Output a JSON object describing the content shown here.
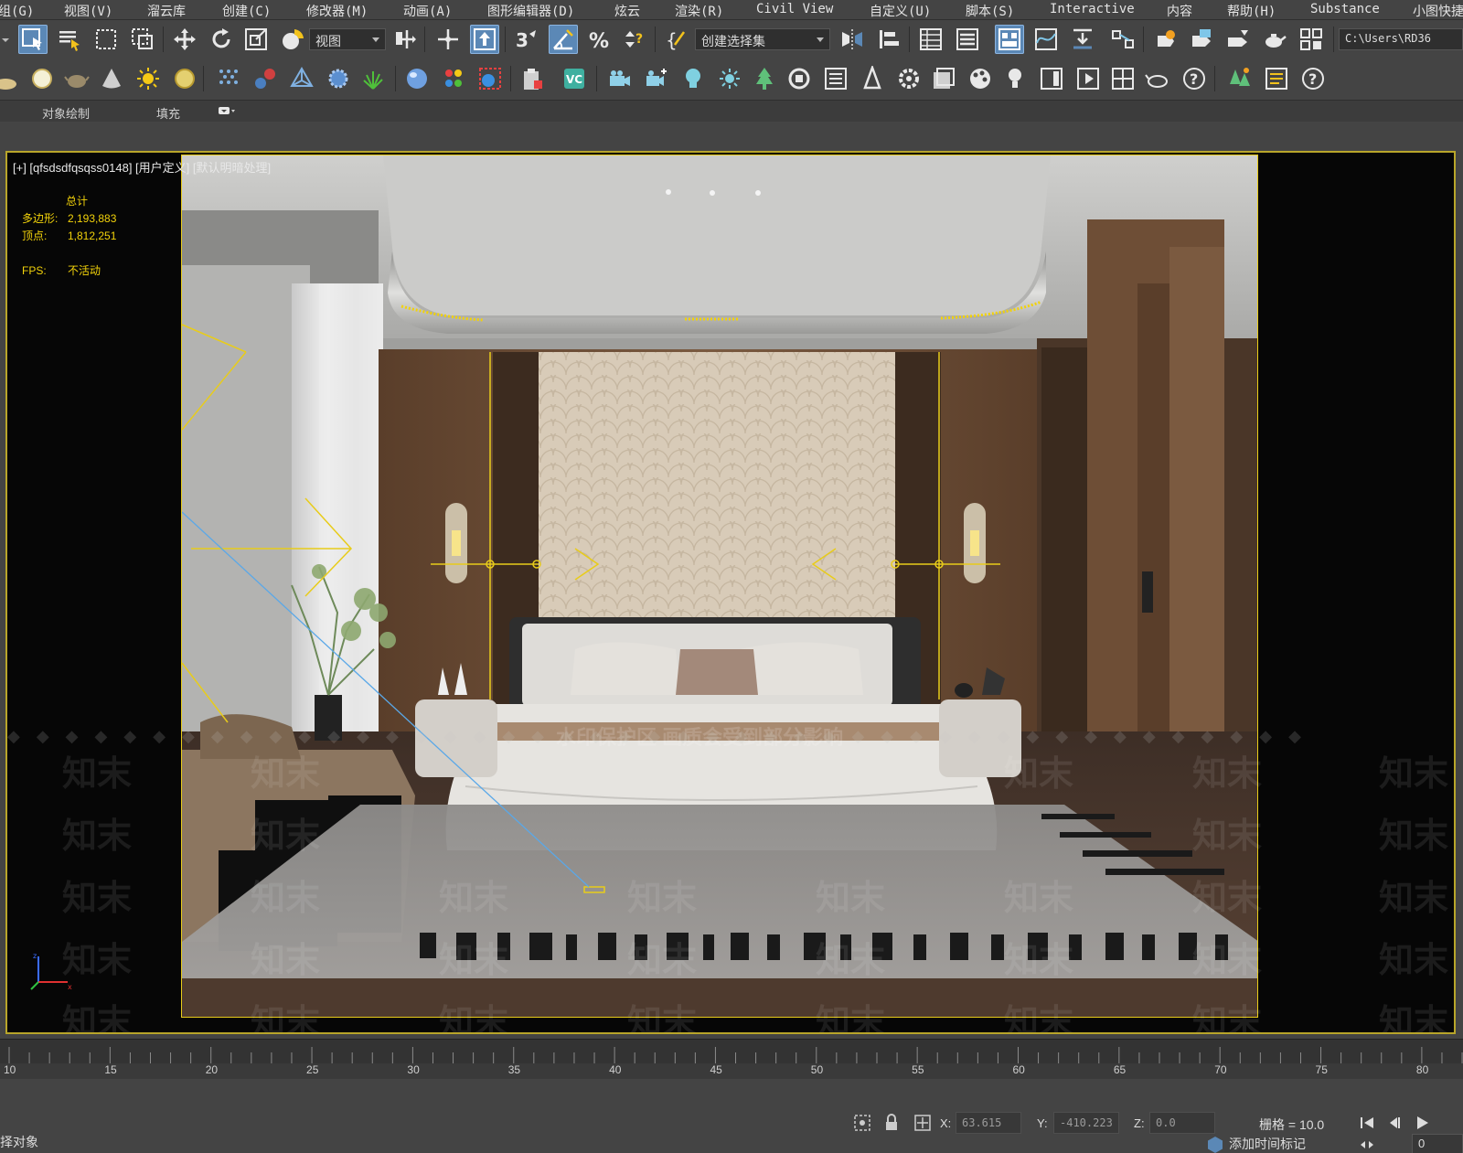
{
  "menubar": {
    "items": [
      "组(G)",
      "视图(V)",
      "溜云库",
      "创建(C)",
      "修改器(M)",
      "动画(A)",
      "图形编辑器(D)",
      "炫云",
      "渲染(R)",
      "Civil View",
      "自定义(U)",
      "脚本(S)",
      "Interactive",
      "内容",
      "帮助(H)",
      "Substance",
      "小图快捷"
    ]
  },
  "toolbar1": {
    "view_dropdown": "视图",
    "selection_set_dropdown": "创建选择集",
    "path_field": "C:\\Users\\RD36"
  },
  "ribbon": {
    "tab_object_paint": "对象绘制",
    "tab_fill": "填充"
  },
  "viewport": {
    "label": "[+] [qfsdsdfqsqss0148] [用户定义] [默认明暗处理]",
    "stats": {
      "total_label": "总计",
      "polys_label": "多边形:",
      "polys_value": "2,193,883",
      "verts_label": "顶点:",
      "verts_value": "1,812,251",
      "fps_label": "FPS:",
      "fps_value": "不活动"
    },
    "watermark_text": "知末",
    "watermark_notice": "水印保护区 画质会受到部分影响"
  },
  "timeline": {
    "ticks": [
      "10",
      "15",
      "20",
      "25",
      "30",
      "35",
      "40",
      "45",
      "50",
      "55",
      "60",
      "65",
      "70",
      "75",
      "80"
    ]
  },
  "statusbar": {
    "left_text": "择对象",
    "x_label": "X:",
    "x_value": "63.615",
    "y_label": "Y:",
    "y_value": "-410.223",
    "z_label": "Z:",
    "z_value": "0.0",
    "grid_label": "栅格 = 10.0",
    "add_time_tag": "添加时间标记",
    "frame_value": "0"
  },
  "colors": {
    "accent_blue": "#5b88b6",
    "viewport_border": "#b8a52a",
    "stats_yellow": "#f2d20a"
  }
}
